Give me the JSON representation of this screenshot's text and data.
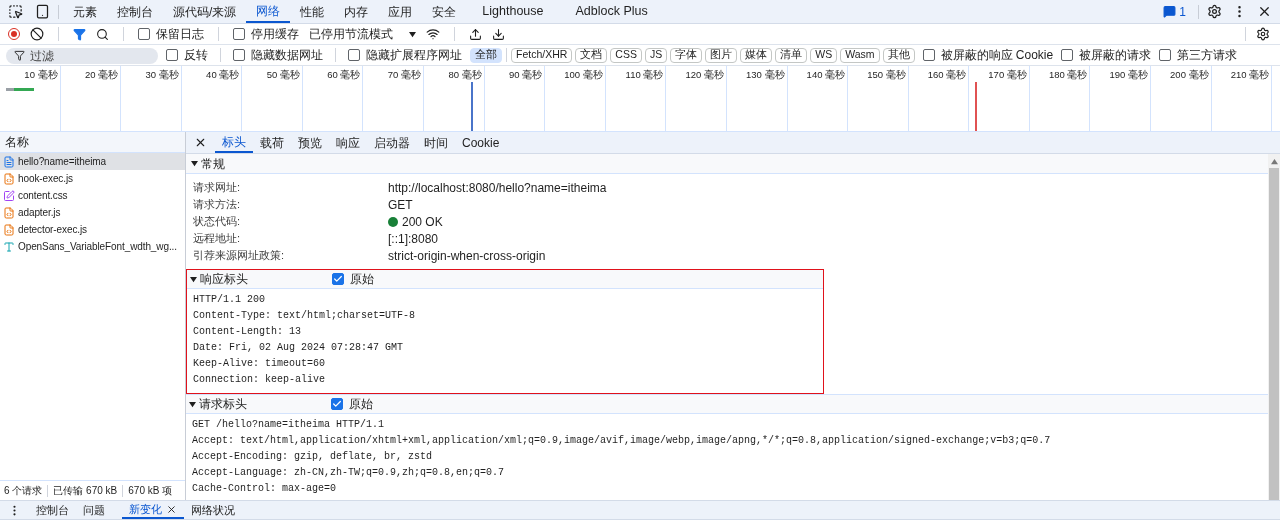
{
  "main_tabs": [
    {
      "label": "元素",
      "selected": false
    },
    {
      "label": "控制台",
      "selected": false
    },
    {
      "label": "源代码/来源",
      "selected": false
    },
    {
      "label": "网络",
      "selected": true
    },
    {
      "label": "性能",
      "selected": false
    },
    {
      "label": "内存",
      "selected": false
    },
    {
      "label": "应用",
      "selected": false
    },
    {
      "label": "安全",
      "selected": false
    },
    {
      "label": "Lighthouse",
      "selected": false
    },
    {
      "label": "Adblock Plus",
      "selected": false
    }
  ],
  "issues_count": "1",
  "toolbar": {
    "preserve_log": {
      "label": "保留日志",
      "checked": false
    },
    "disable_cache": {
      "label": "停用缓存",
      "checked": false
    },
    "throttle": "已停用节流模式"
  },
  "filter": {
    "placeholder": "过滤",
    "options": [
      {
        "label": "反转",
        "checked": false
      },
      {
        "label": "隐藏数据网址",
        "checked": false
      },
      {
        "label": "隐藏扩展程序网址",
        "checked": false
      }
    ],
    "types": [
      {
        "label": "全部",
        "selected": true
      },
      {
        "label": "Fetch/XHR",
        "selected": false
      },
      {
        "label": "文档",
        "selected": false
      },
      {
        "label": "CSS",
        "selected": false
      },
      {
        "label": "JS",
        "selected": false
      },
      {
        "label": "字体",
        "selected": false
      },
      {
        "label": "图片",
        "selected": false
      },
      {
        "label": "媒体",
        "selected": false
      },
      {
        "label": "清单",
        "selected": false
      },
      {
        "label": "WS",
        "selected": false
      },
      {
        "label": "Wasm",
        "selected": false
      },
      {
        "label": "其他",
        "selected": false
      }
    ],
    "extra_options": [
      {
        "label": "被屏蔽的响应 Cookie",
        "checked": false
      },
      {
        "label": "被屏蔽的请求",
        "checked": false
      },
      {
        "label": "第三方请求",
        "checked": false
      }
    ]
  },
  "timeline": {
    "ticks": [
      "10 毫秒",
      "20 毫秒",
      "30 毫秒",
      "40 毫秒",
      "50 毫秒",
      "60 毫秒",
      "70 毫秒",
      "80 毫秒",
      "90 毫秒",
      "100 毫秒",
      "110 毫秒",
      "120 毫秒",
      "130 毫秒",
      "140 毫秒",
      "150 毫秒",
      "160 毫秒",
      "170 毫秒",
      "180 毫秒",
      "190 毫秒",
      "200 毫秒",
      "210 毫秒"
    ]
  },
  "requests": {
    "header": "名称",
    "items": [
      {
        "name": "hello?name=itheima",
        "kind": "document",
        "selected": true
      },
      {
        "name": "hook-exec.js",
        "kind": "script",
        "selected": false
      },
      {
        "name": "content.css",
        "kind": "stylesheet",
        "selected": false
      },
      {
        "name": "adapter.js",
        "kind": "script",
        "selected": false
      },
      {
        "name": "detector-exec.js",
        "kind": "script",
        "selected": false
      },
      {
        "name": "OpenSans_VariableFont_wdth_wg...",
        "kind": "font",
        "selected": false
      }
    ]
  },
  "status_bar": [
    "6 个请求",
    "已传输 670 kB",
    "670 kB 项"
  ],
  "detail_tabs": [
    {
      "label": "标头",
      "selected": true
    },
    {
      "label": "载荷",
      "selected": false
    },
    {
      "label": "预览",
      "selected": false
    },
    {
      "label": "响应",
      "selected": false
    },
    {
      "label": "启动器",
      "selected": false
    },
    {
      "label": "时间",
      "selected": false
    },
    {
      "label": "Cookie",
      "selected": false
    }
  ],
  "general": {
    "title": "常规",
    "expanded": true,
    "rows": [
      {
        "label": "请求网址:",
        "value": "http://localhost:8080/hello?name=itheima",
        "kind": "text"
      },
      {
        "label": "请求方法:",
        "value": "GET",
        "kind": "text"
      },
      {
        "label": "状态代码:",
        "value": "200 OK",
        "kind": "status",
        "color": "#188038"
      },
      {
        "label": "远程地址:",
        "value": "[::1]:8080",
        "kind": "text"
      },
      {
        "label": "引荐来源网址政策:",
        "value": "strict-origin-when-cross-origin",
        "kind": "text"
      }
    ]
  },
  "header_sections": [
    {
      "title": "响应标头",
      "expanded": true,
      "raw": {
        "label": "原始",
        "checked": true
      },
      "highlighted": true,
      "lines": [
        "HTTP/1.1 200",
        "Content-Type: text/html;charset=UTF-8",
        "Content-Length: 13",
        "Date: Fri, 02 Aug 2024 07:28:47 GMT",
        "Keep-Alive: timeout=60",
        "Connection: keep-alive"
      ]
    },
    {
      "title": "请求标头",
      "expanded": true,
      "raw": {
        "label": "原始",
        "checked": true
      },
      "highlighted": false,
      "lines": [
        "GET /hello?name=itheima HTTP/1.1",
        "Accept: text/html,application/xhtml+xml,application/xml;q=0.9,image/avif,image/webp,image/apng,*/*;q=0.8,application/signed-exchange;v=b3;q=0.7",
        "Accept-Encoding: gzip, deflate, br, zstd",
        "Accept-Language: zh-CN,zh-TW;q=0.9,zh;q=0.8,en;q=0.7",
        "Cache-Control: max-age=0"
      ]
    }
  ],
  "drawer_tabs": [
    {
      "label": "控制台",
      "selected": false,
      "closable": false
    },
    {
      "label": "问题",
      "selected": false,
      "closable": false
    },
    {
      "label": "新变化",
      "selected": true,
      "closable": true
    },
    {
      "label": "网络状况",
      "selected": false,
      "closable": false
    }
  ]
}
